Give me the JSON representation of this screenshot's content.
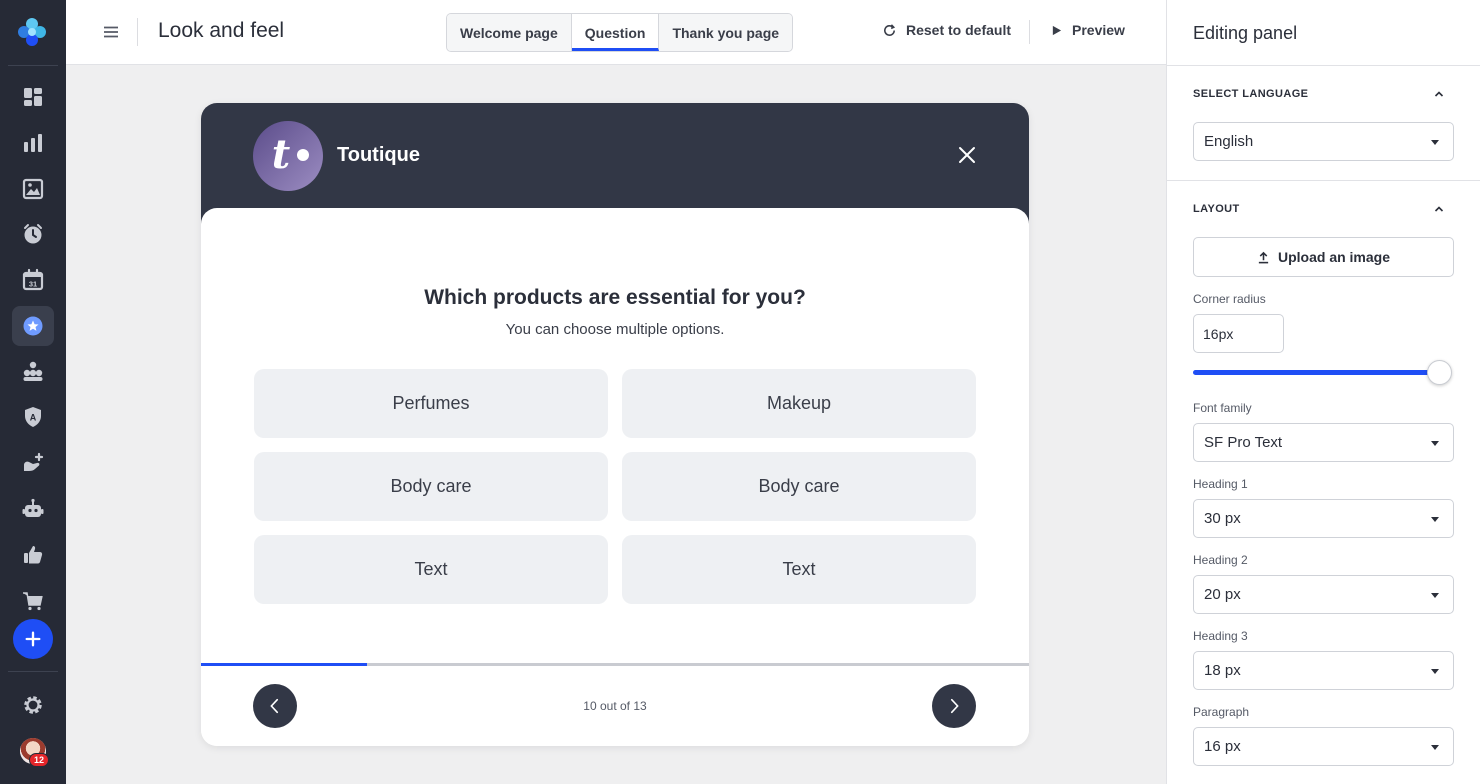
{
  "topbar": {
    "title": "Look and feel",
    "tabs": [
      {
        "label": "Welcome page",
        "active": false
      },
      {
        "label": "Question",
        "active": true
      },
      {
        "label": "Thank you page",
        "active": false
      }
    ],
    "reset_label": "Reset to default",
    "preview_label": "Preview"
  },
  "rail": {
    "items": [
      "dashboard-icon",
      "bar-chart-icon",
      "image-icon",
      "clock-icon",
      "calendar-icon",
      "star-badge-icon",
      "org-chart-icon",
      "shield-icon",
      "hand-plus-icon",
      "robot-icon",
      "thumbs-up-icon",
      "cart-icon"
    ],
    "active_item": "star-badge-icon",
    "calendar_day": "31",
    "shield_letter": "A",
    "notification_count": "12"
  },
  "survey": {
    "brand_name": "Toutique",
    "brand_initial": "t",
    "question": "Which products are essential for you?",
    "subtitle": "You can choose multiple options.",
    "options": [
      "Perfumes",
      "Makeup",
      "Body care",
      "Body care",
      "Text",
      "Text"
    ],
    "pager": "10 out of 13",
    "progress": 0.2
  },
  "panel": {
    "title": "Editing panel",
    "language_section": "SELECT LANGUAGE",
    "language_value": "English",
    "layout_section": "LAYOUT",
    "upload_label": "Upload an image",
    "corner_radius_label": "Corner radius",
    "corner_radius_value": "16px",
    "corner_radius_slider": 1.0,
    "font_family_label": "Font family",
    "font_family_value": "SF Pro Text",
    "heading1_label": "Heading 1",
    "heading1_value": "30 px",
    "heading2_label": "Heading 2",
    "heading2_value": "20 px",
    "heading3_label": "Heading 3",
    "heading3_value": "18 px",
    "paragraph_label": "Paragraph",
    "paragraph_value": "16 px"
  },
  "colors": {
    "accent": "#1f4ef5",
    "rail_bg": "#262a36",
    "card_header": "#323746",
    "option_bg": "#eef0f3"
  }
}
